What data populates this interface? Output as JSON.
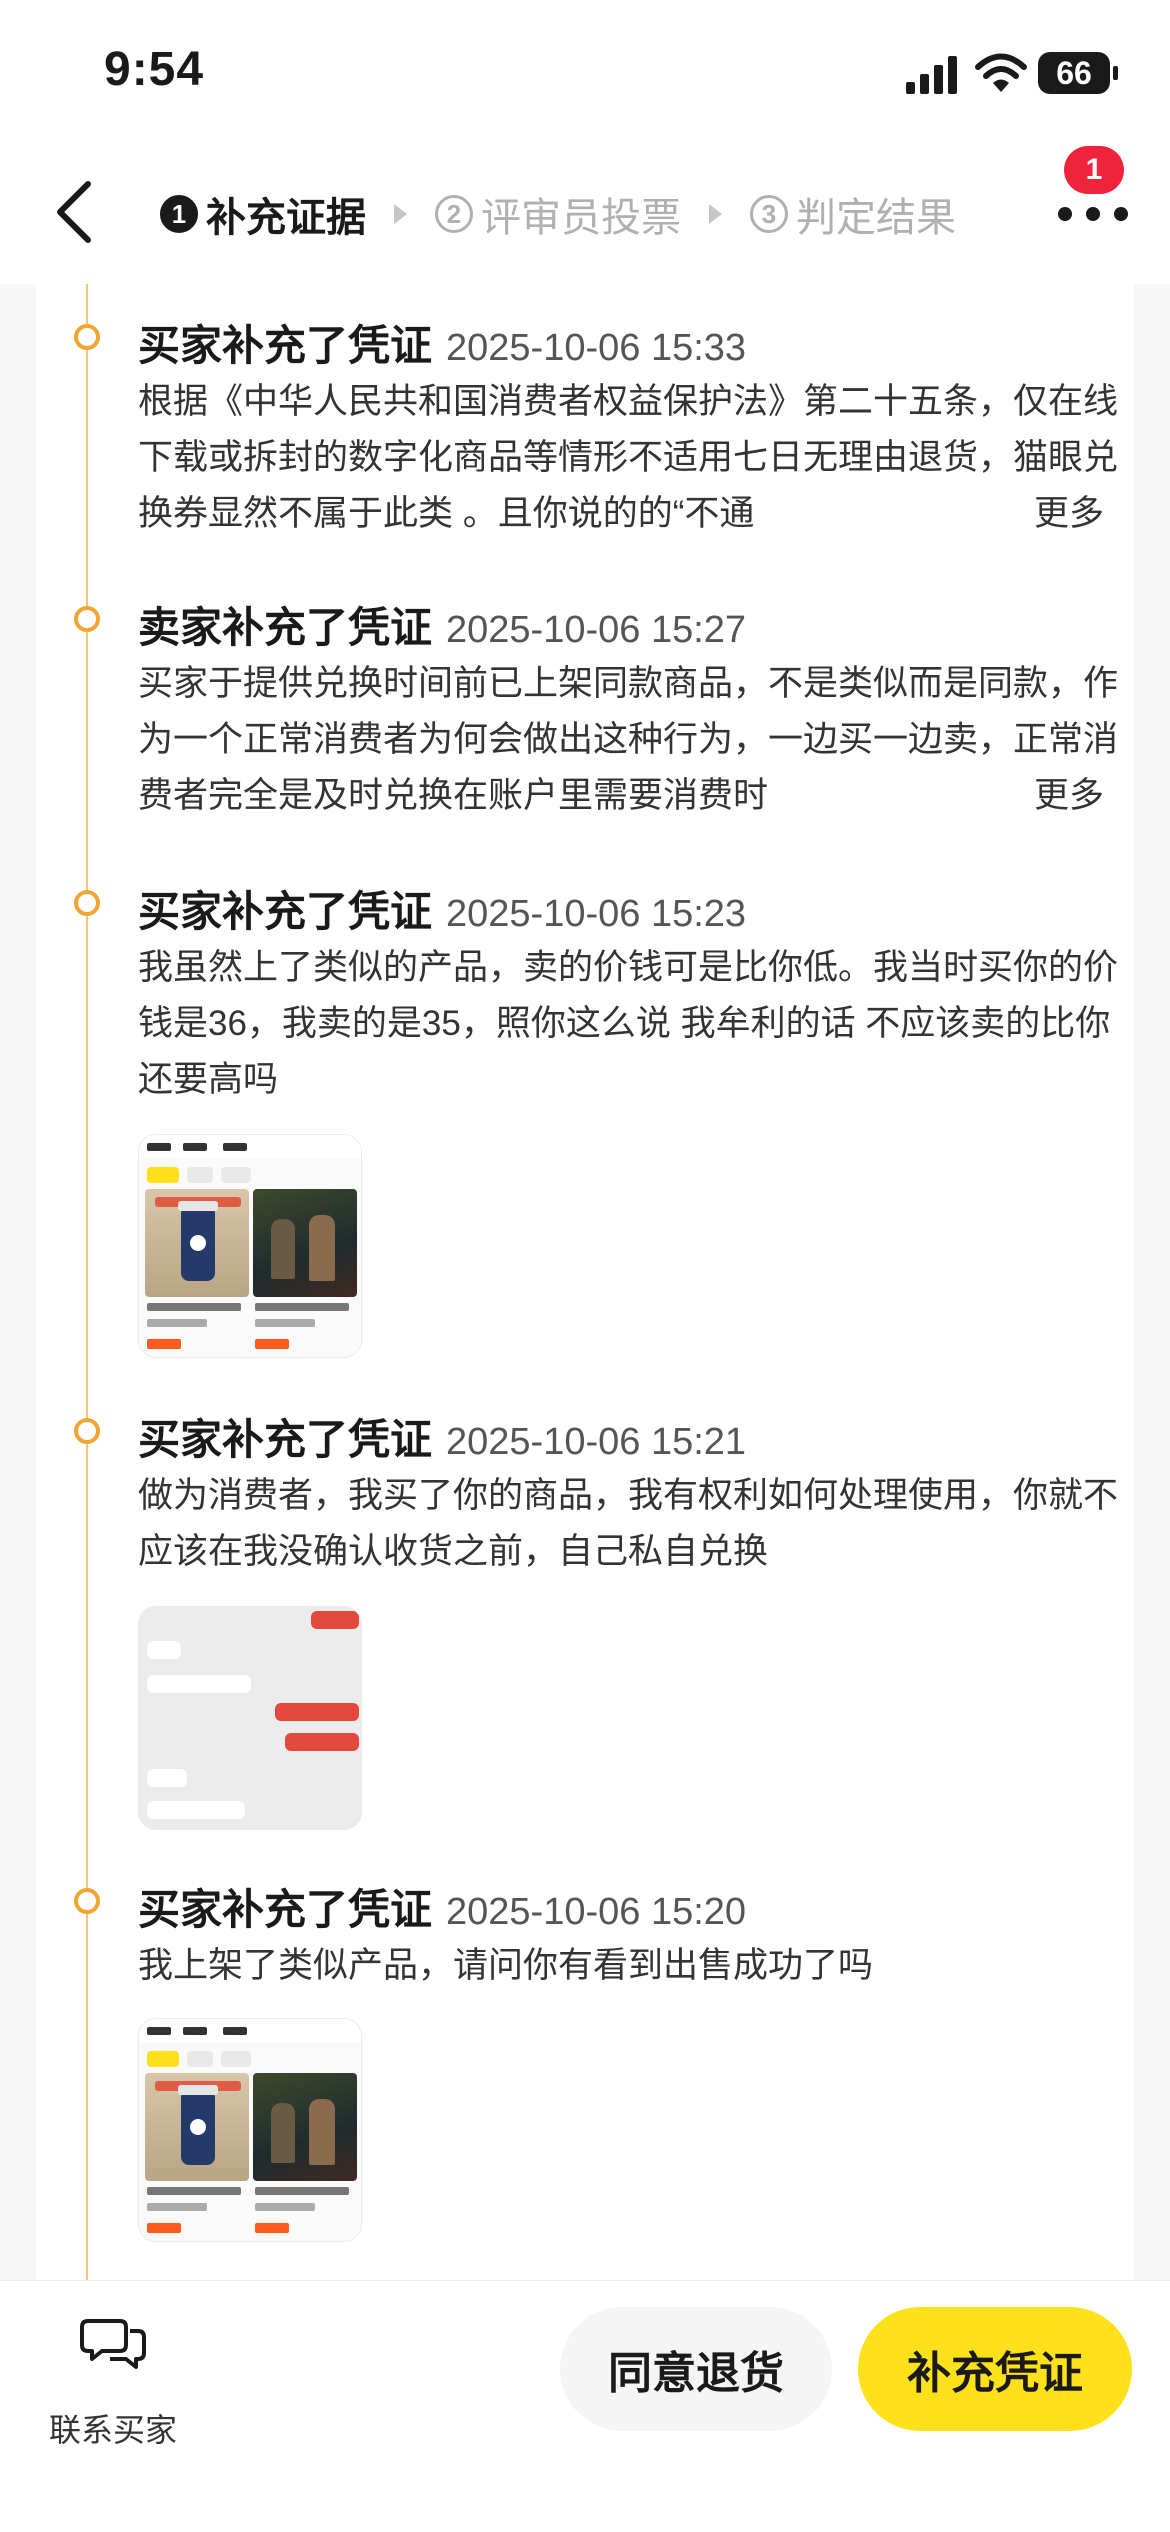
{
  "status_bar": {
    "time": "9:54",
    "battery": "66",
    "icons": [
      "signal-icon",
      "wifi-icon",
      "battery-icon"
    ]
  },
  "nav": {
    "back_icon": "chevron-left-icon",
    "steps": [
      {
        "num": "1",
        "label": "补充证据",
        "active": true
      },
      {
        "num": "2",
        "label": "评审员投票",
        "active": false
      },
      {
        "num": "3",
        "label": "判定结果",
        "active": false
      }
    ],
    "more_icon": "more-dots-icon",
    "badge_count": "1"
  },
  "timeline": [
    {
      "title": "买家补充了凭证",
      "time": "2025-10-06 15:33",
      "text": "根据《中华人民共和国消费者权益保护法》第二十五条，仅在线下载或拆封的数字化商品等情形不适用七日无理由退货，猫眼兑换券显然不属于此类 。且你说的的“不通",
      "more": "更多",
      "image": null
    },
    {
      "title": "卖家补充了凭证",
      "time": "2025-10-06 15:27",
      "text": "买家于提供兑换时间前已上架同款商品，不是类似而是同款，作为一个正常消费者为何会做出这种行为，一边买一边卖，正常消费者完全是及时兑换在账户里需要消费时",
      "more": "更多",
      "image": null
    },
    {
      "title": "买家补充了凭证",
      "time": "2025-10-06 15:23",
      "text": "我虽然上了类似的产品，卖的价钱可是比你低。我当时买你的价钱是36，我卖的是35，照你这么说 我牟利的话 不应该卖的比你还要高吗",
      "more": "",
      "image": "shop-screenshot"
    },
    {
      "title": "买家补充了凭证",
      "time": "2025-10-06 15:21",
      "text": "做为消费者，我买了你的商品，我有权利如何处理使用，你就不应该在我没确认收货之前，自己私自兑换",
      "more": "",
      "image": "chat-screenshot"
    },
    {
      "title": "买家补充了凭证",
      "time": "2025-10-06 15:20",
      "text": "我上架了类似产品，请问你有看到出售成功了吗",
      "more": "",
      "image": "shop-screenshot"
    }
  ],
  "bottom_bar": {
    "contact_label": "联系买家",
    "contact_icon": "chat-bubbles-icon",
    "agree_label": "同意退货",
    "evidence_label": "补充凭证"
  },
  "colors": {
    "accent_yellow": "#ffe11b",
    "timeline_orange": "#f3a531",
    "badge_red": "#f0233c"
  }
}
